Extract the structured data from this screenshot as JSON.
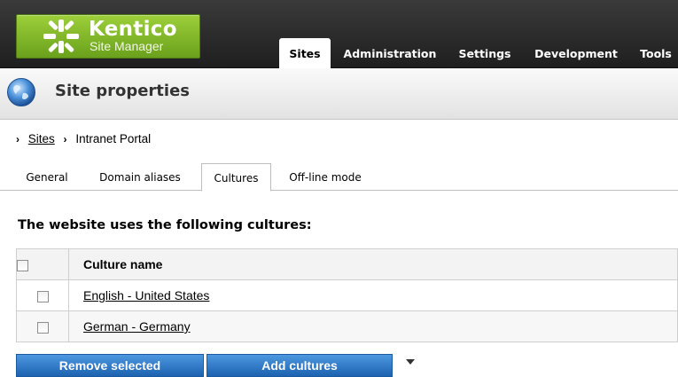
{
  "logo": {
    "brand": "Kentico",
    "subtitle": "Site Manager"
  },
  "main_tabs": [
    {
      "label": "Sites",
      "active": true
    },
    {
      "label": "Administration"
    },
    {
      "label": "Settings"
    },
    {
      "label": "Development"
    },
    {
      "label": "Tools"
    }
  ],
  "page": {
    "title": "Site properties",
    "icon": "globe-icon"
  },
  "breadcrumb": {
    "root": "Sites",
    "current": "Intranet Portal"
  },
  "sub_tabs": [
    {
      "label": "General"
    },
    {
      "label": "Domain aliases"
    },
    {
      "label": "Cultures",
      "active": true
    },
    {
      "label": "Off-line mode"
    }
  ],
  "section": {
    "title": "The website uses the following cultures:"
  },
  "grid": {
    "header": "Culture name",
    "rows": [
      {
        "name": "English - United States"
      },
      {
        "name": "German - Germany"
      }
    ]
  },
  "actions": {
    "remove": "Remove selected",
    "add": "Add cultures"
  },
  "colors": {
    "brand_green": "#7fba28",
    "button_blue": "#2a73c5",
    "header_dark": "#2b2b2b"
  }
}
